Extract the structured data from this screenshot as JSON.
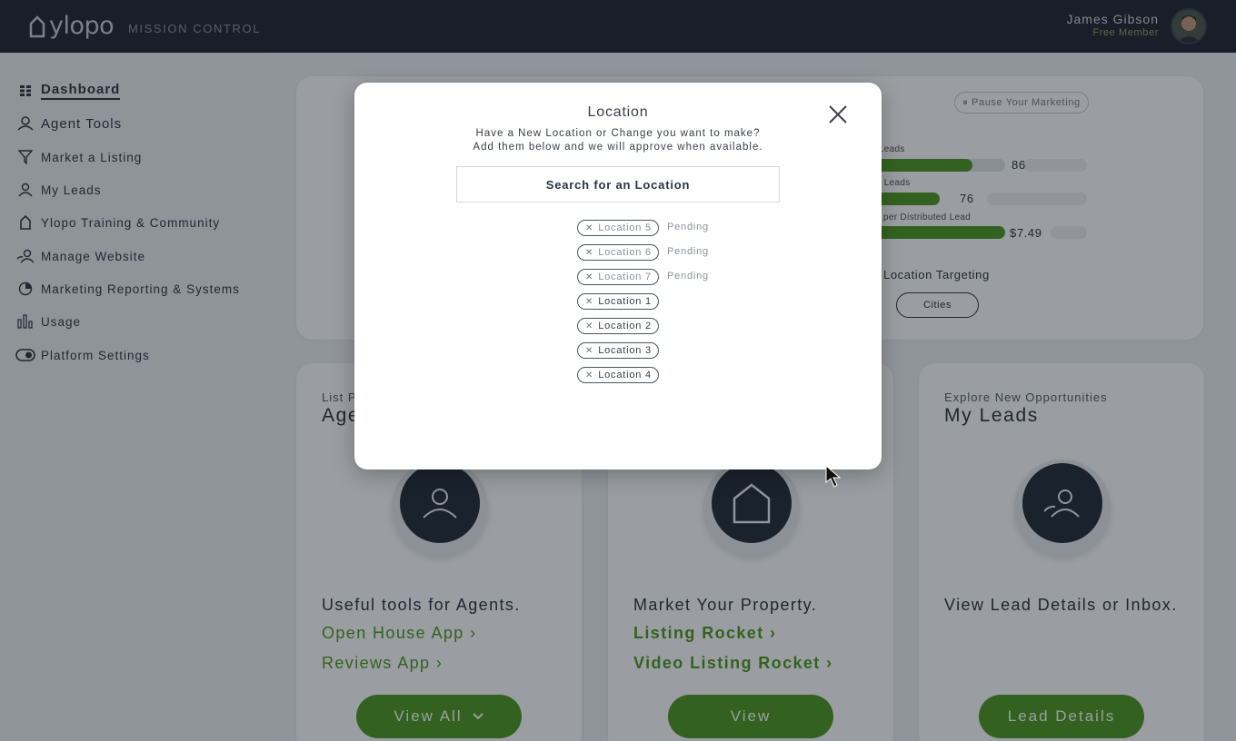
{
  "header": {
    "logo_text": "ylopo",
    "subtitle": "MISSION CONTROL",
    "user_name": "James Gibson",
    "user_role": "Free Member"
  },
  "sidebar": {
    "items": [
      {
        "label": "Dashboard",
        "icon": "grid-icon"
      },
      {
        "label": "Agent Tools",
        "icon": "person-icon"
      },
      {
        "label": "Market a Listing",
        "icon": "funnel-icon"
      },
      {
        "label": "My Leads",
        "icon": "person-icon"
      },
      {
        "label": "Ylopo Training & Community",
        "icon": "house-icon"
      },
      {
        "label": "Manage Website",
        "icon": "people-icon"
      },
      {
        "label": "Marketing Reporting & Systems",
        "icon": "pie-chart-icon"
      },
      {
        "label": "Usage",
        "icon": "bar-chart-icon"
      },
      {
        "label": "Platform Settings",
        "icon": "toggle-icon"
      }
    ]
  },
  "top_card": {
    "pause_label": "⏸ Pause Your Marketing",
    "stats": [
      {
        "label": "d Leads",
        "value": "86",
        "fill": 0.6
      },
      {
        "label": "ed Leads",
        "value": "76",
        "fill": 0.53
      },
      {
        "label": "per Distributed Lead",
        "value": "$7.49",
        "fill": 0.99
      }
    ],
    "location_targeting": "Location Targeting",
    "cities_label": "Cities"
  },
  "tiles": [
    {
      "kicker": "List P",
      "title": "Age",
      "desc": "Useful tools for Agents.",
      "links": [
        "Open House App ›",
        "Reviews App ›"
      ],
      "button": "View All"
    },
    {
      "kicker": "",
      "title": "",
      "desc": "Market Your Property.",
      "links": [
        "Listing Rocket ›",
        "Video Listing Rocket ›"
      ],
      "button": "View"
    },
    {
      "kicker": "Explore New Opportunities",
      "title": "My Leads",
      "desc": "View Lead Details or Inbox.",
      "links": [],
      "button": "Lead Details"
    }
  ],
  "modal": {
    "title": "Location",
    "subtitle_line1": "Have a New Location or Change you want to make?",
    "subtitle_line2": "Add them below and we will approve when available.",
    "search_placeholder": "Search for an Location",
    "locations": [
      {
        "name": "Location 5",
        "status": "Pending"
      },
      {
        "name": "Location 6",
        "status": "Pending"
      },
      {
        "name": "Location 7",
        "status": "Pending"
      },
      {
        "name": "Location 1",
        "status": ""
      },
      {
        "name": "Location 2",
        "status": ""
      },
      {
        "name": "Location 3",
        "status": ""
      },
      {
        "name": "Location 4",
        "status": ""
      }
    ]
  },
  "colors": {
    "brand_green": "#4f9a21",
    "topbar_bg": "#20262f",
    "dark_circle": "#232b36"
  }
}
